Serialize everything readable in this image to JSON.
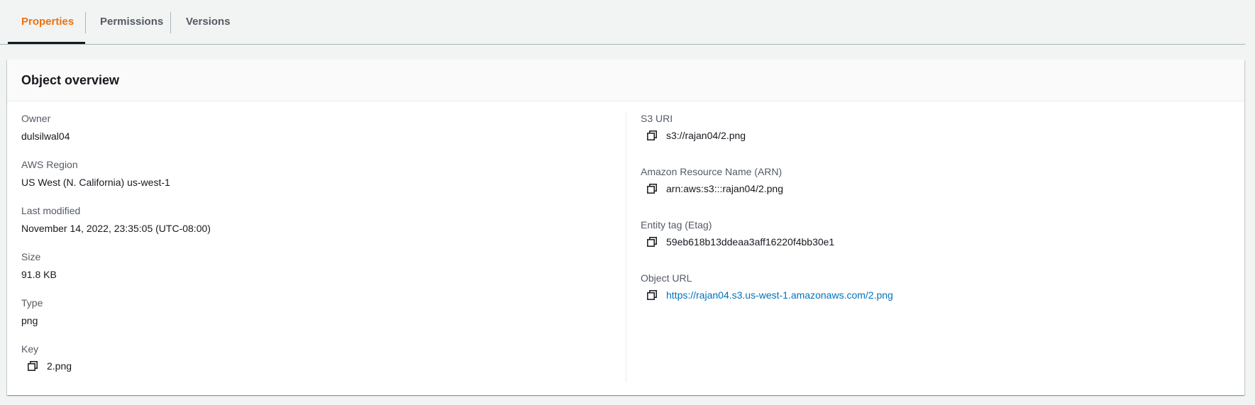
{
  "tabs": [
    {
      "label": "Properties",
      "active": true
    },
    {
      "label": "Permissions",
      "active": false
    },
    {
      "label": "Versions",
      "active": false
    }
  ],
  "overview": {
    "title": "Object overview",
    "left": {
      "owner": {
        "label": "Owner",
        "value": "dulsilwal04"
      },
      "region": {
        "label": "AWS Region",
        "value": "US West (N. California) us-west-1"
      },
      "last_modified": {
        "label": "Last modified",
        "value": "November 14, 2022, 23:35:05 (UTC-08:00)"
      },
      "size": {
        "label": "Size",
        "value": "91.8 KB"
      },
      "type": {
        "label": "Type",
        "value": "png"
      },
      "key": {
        "label": "Key",
        "value": "2.png"
      }
    },
    "right": {
      "s3_uri": {
        "label": "S3 URI",
        "value": "s3://rajan04/2.png"
      },
      "arn": {
        "label": "Amazon Resource Name (ARN)",
        "value": "arn:aws:s3:::rajan04/2.png"
      },
      "etag": {
        "label": "Entity tag (Etag)",
        "value": "59eb618b13ddeaa3aff16220f4bb30e1"
      },
      "object_url": {
        "label": "Object URL",
        "value": "https://rajan04.s3.us-west-1.amazonaws.com/2.png"
      }
    }
  },
  "colors": {
    "accent_tab": "#ec7211",
    "link": "#0073bb",
    "text": "#16191f",
    "label": "#545b64",
    "page_bg": "#f2f3f3"
  },
  "icons": {
    "copy": "copy-icon"
  }
}
